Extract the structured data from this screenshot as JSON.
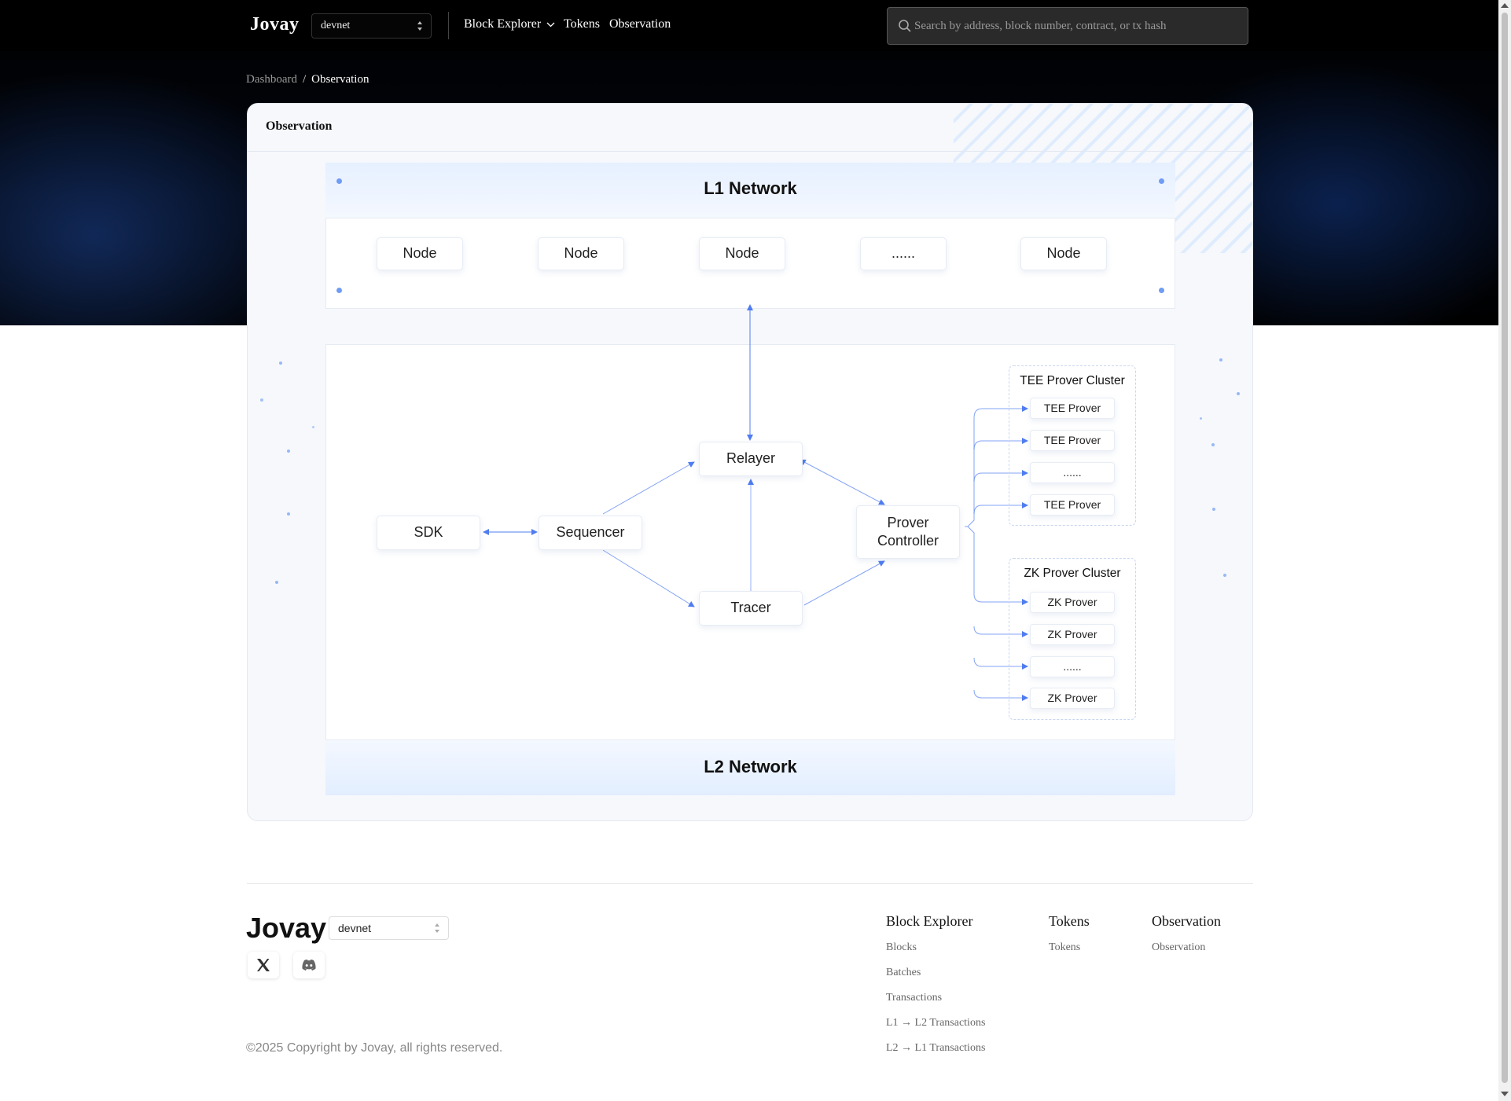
{
  "header": {
    "logo": "Jovay",
    "network": "devnet",
    "nav": [
      {
        "label": "Block Explorer"
      },
      {
        "label": "Tokens"
      },
      {
        "label": "Observation"
      }
    ],
    "search_placeholder": "Search by address, block number, contract, or tx hash"
  },
  "breadcrumb": {
    "home": "Dashboard",
    "separator": "/",
    "current": "Observation"
  },
  "card": {
    "title": "Observation",
    "l1": {
      "title": "L1 Network",
      "nodes": [
        "Node",
        "Node",
        "Node",
        "......",
        "Node"
      ]
    },
    "l2": {
      "title": "L2 Network",
      "sdk": "SDK",
      "sequencer": "Sequencer",
      "relayer": "Relayer",
      "tracer": "Tracer",
      "prover_controller": "Prover Controller",
      "tee_cluster": {
        "title": "TEE Prover Cluster",
        "items": [
          "TEE Prover",
          "TEE Prover",
          "......",
          "TEE Prover"
        ]
      },
      "zk_cluster": {
        "title": "ZK Prover Cluster",
        "items": [
          "ZK Prover",
          "ZK Prover",
          "......",
          "ZK Prover"
        ]
      }
    }
  },
  "footer": {
    "logo": "Jovay",
    "network": "devnet",
    "social": [
      "x-icon",
      "discord-icon"
    ],
    "columns": [
      {
        "title": "Block Explorer",
        "links": [
          "Blocks",
          "Batches",
          "Transactions",
          "L1 → L2 Transactions",
          "L2 → L1 Transactions"
        ]
      },
      {
        "title": "Tokens",
        "links": [
          "Tokens"
        ]
      },
      {
        "title": "Observation",
        "links": [
          "Observation"
        ]
      }
    ],
    "copyright": "©2025 Copyright by Jovay, all rights reserved."
  },
  "colors": {
    "accent": "#4f7cf0",
    "band": "#e6f0ff",
    "header_bg": "#000000"
  }
}
